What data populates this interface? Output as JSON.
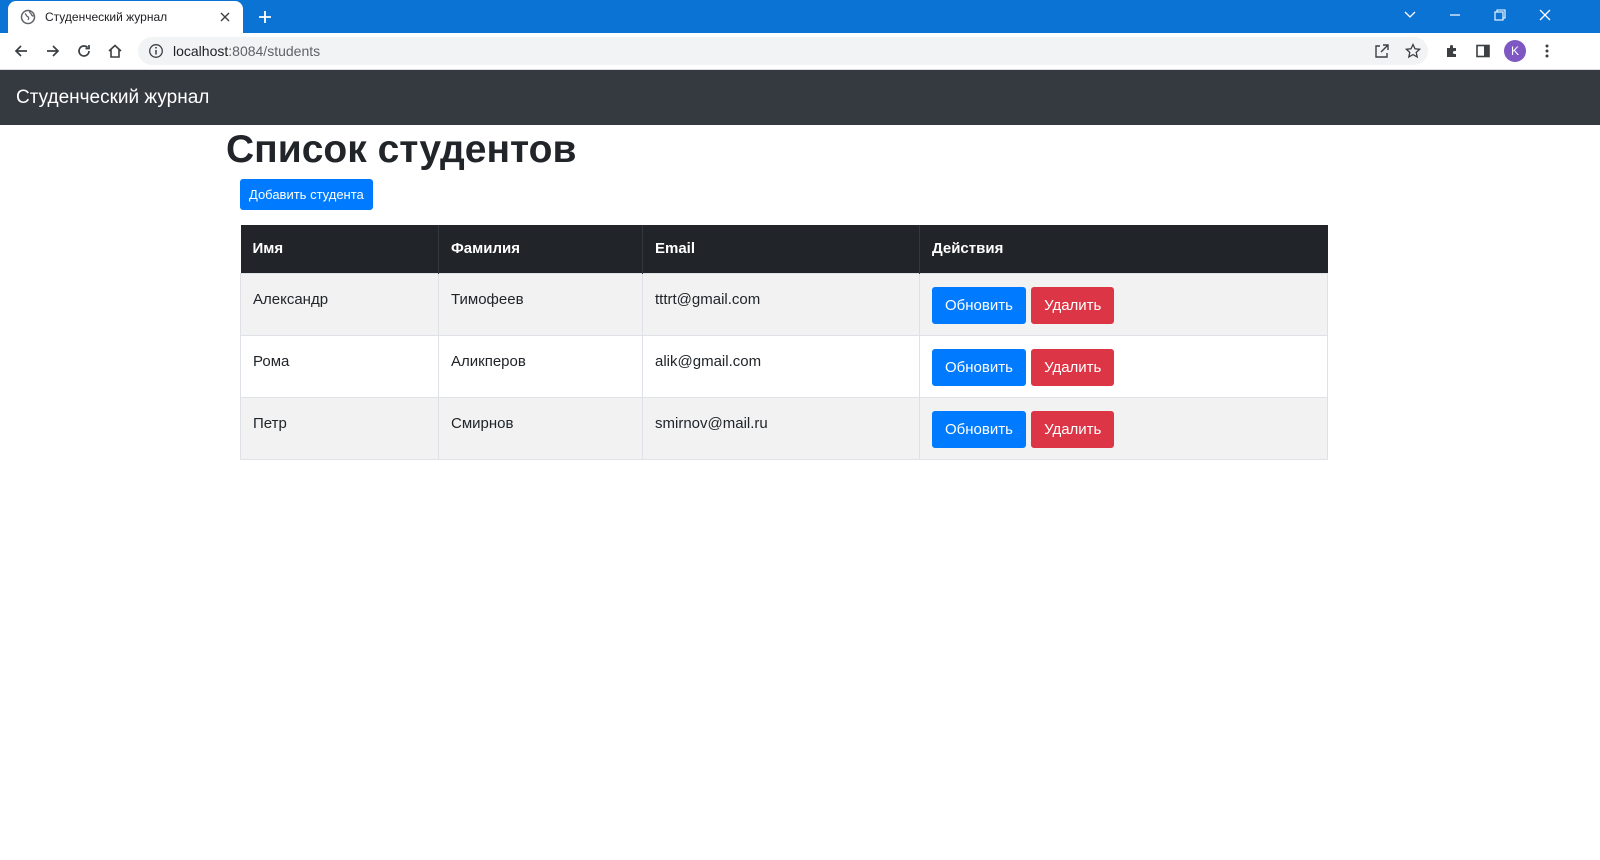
{
  "browser": {
    "tab_title": "Студенческий журнал",
    "url_host": "localhost",
    "url_path": ":8084/students",
    "profile_initial": "K"
  },
  "navbar": {
    "brand": "Студенческий журнал"
  },
  "page": {
    "title": "Список студентов",
    "add_button": "Добавить студента"
  },
  "table": {
    "headers": [
      "Имя",
      "Фамилия",
      "Email",
      "Действия"
    ],
    "rows": [
      {
        "first_name": "Александр",
        "last_name": "Тимофеев",
        "email": "tttrt@gmail.com",
        "update": "Обновить",
        "delete": "Удалить"
      },
      {
        "first_name": "Рома",
        "last_name": "Аликперов",
        "email": "alik@gmail.com",
        "update": "Обновить",
        "delete": "Удалить"
      },
      {
        "first_name": "Петр",
        "last_name": "Смирнов",
        "email": "smirnov@mail.ru",
        "update": "Обновить",
        "delete": "Удалить"
      }
    ]
  },
  "colors": {
    "browser_tabbar": "#0a73d4",
    "navbar": "#343a40",
    "primary": "#007bff",
    "danger": "#dc3545",
    "table_header": "#212529"
  }
}
